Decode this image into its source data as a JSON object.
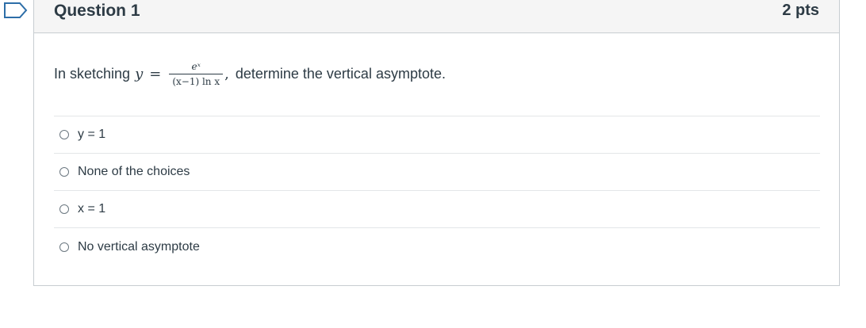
{
  "question": {
    "title": "Question 1",
    "points": "2 pts",
    "prompt_before": "In sketching",
    "math_var": "y",
    "math_eq": "=",
    "frac_num": "eˣ",
    "frac_den": "(x−1) ln x",
    "math_comma": ",",
    "prompt_after": "determine the vertical asymptote."
  },
  "answers": [
    {
      "label": "y = 1"
    },
    {
      "label": "None of the choices"
    },
    {
      "label": "x = 1"
    },
    {
      "label": "No vertical asymptote"
    }
  ],
  "colors": {
    "text": "#2d3b45",
    "border": "#c7cdd1",
    "header_bg": "#f5f5f5",
    "flag": "#2d6ea8"
  }
}
